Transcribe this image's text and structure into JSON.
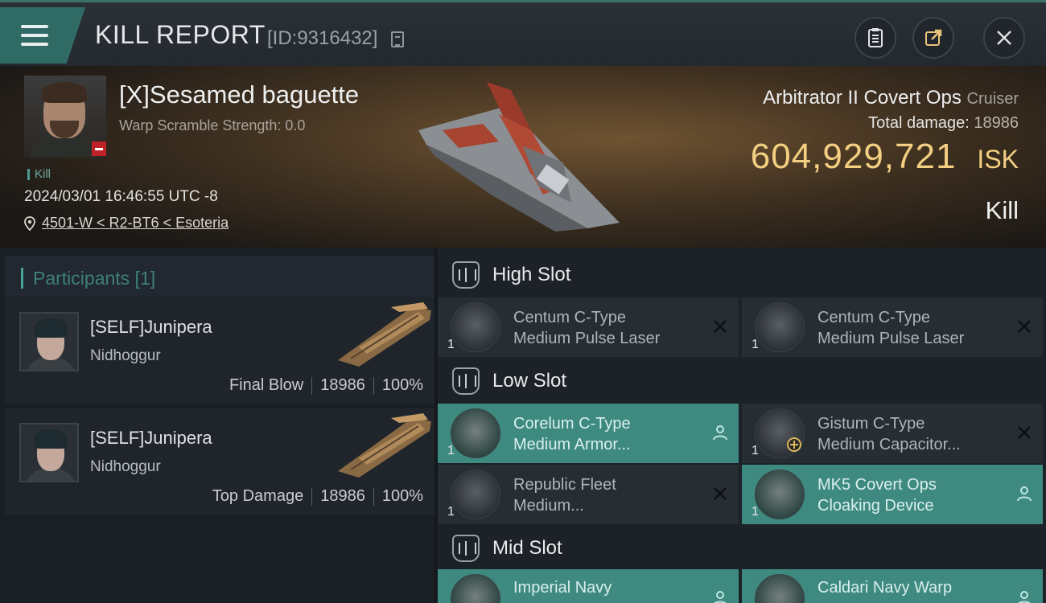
{
  "header": {
    "title": "KILL REPORT",
    "kill_id": "[ID:9316432]"
  },
  "victim": {
    "name": "[X]Sesamed baguette",
    "warp_scramble": "Warp Scramble Strength: 0.0",
    "tag": "Kill",
    "datetime": "2024/03/01 16:46:55 UTC -8",
    "location": "4501-W < R2-BT6 < Esoteria",
    "ship_name": "Arbitrator II Covert Ops",
    "ship_class": "Cruiser",
    "total_damage_label": "Total damage:",
    "total_damage": "18986",
    "isk_value": "604,929,721",
    "isk_unit": "ISK",
    "result": "Kill"
  },
  "participants": {
    "label": "Participants [1]",
    "items": [
      {
        "name": "[SELF]Junipera",
        "ship": "Nidhoggur",
        "role": "Final Blow",
        "damage": "18986",
        "percent": "100%"
      },
      {
        "name": "[SELF]Junipera",
        "ship": "Nidhoggur",
        "role": "Top Damage",
        "damage": "18986",
        "percent": "100%"
      }
    ]
  },
  "slots": {
    "high": {
      "title": "High Slot",
      "modules": [
        {
          "line1": "Centum C-Type",
          "line2": "Medium Pulse Laser",
          "qty": "1",
          "state": "destroyed"
        },
        {
          "line1": "Centum C-Type",
          "line2": "Medium Pulse Laser",
          "qty": "1",
          "state": "destroyed"
        }
      ]
    },
    "low": {
      "title": "Low Slot",
      "modules": [
        {
          "line1": "Corelum C-Type",
          "line2": "Medium Armor...",
          "qty": "1",
          "state": "dropped"
        },
        {
          "line1": "Gistum C-Type",
          "line2": "Medium Capacitor...",
          "qty": "1",
          "state": "destroyed"
        },
        {
          "line1": "Republic Fleet",
          "line2": "Medium...",
          "qty": "1",
          "state": "destroyed"
        },
        {
          "line1": "MK5 Covert Ops",
          "line2": "Cloaking Device",
          "qty": "1",
          "state": "dropped"
        }
      ]
    },
    "mid": {
      "title": "Mid Slot",
      "modules": [
        {
          "line1": "Imperial Navy",
          "line2": "",
          "qty": "",
          "state": "dropped"
        },
        {
          "line1": "Caldari Navy Warp",
          "line2": "",
          "qty": "",
          "state": "dropped"
        }
      ]
    }
  },
  "colors": {
    "accent_teal": "#3f8a80",
    "isk_gold": "#f3cf82",
    "negative_red": "#c0222a"
  }
}
